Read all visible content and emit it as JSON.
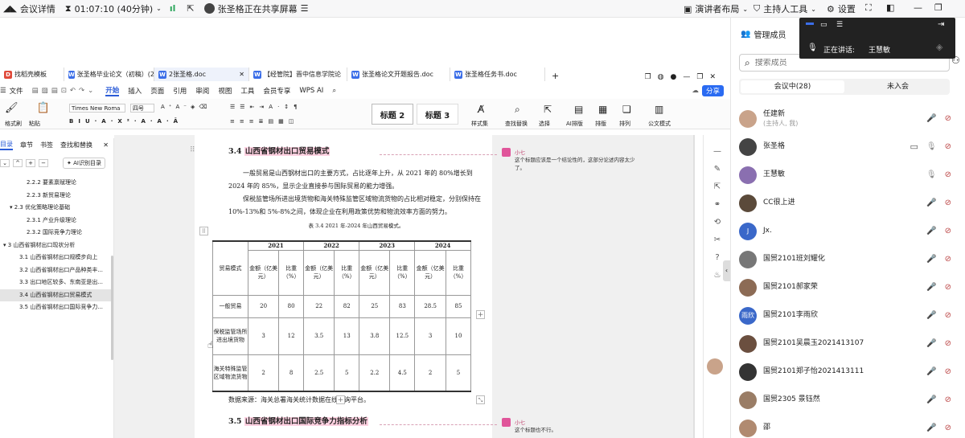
{
  "meeting_bar": {
    "details": "会议详情",
    "timer": "01:07:10 (40分钟)",
    "sharing": "张圣格正在共享屏幕",
    "layout": "演讲者布局",
    "host_tools": "主持人工具",
    "settings": "设置"
  },
  "float": {
    "speaking_label": "正在讲话:",
    "speaker": "王慧敏"
  },
  "doc_tabs": [
    {
      "label": "找稻壳模板"
    },
    {
      "label": "张圣格毕业论文（初稿）(2).d"
    },
    {
      "label": "2张圣格.doc"
    },
    {
      "label": "【经管院】晋中信息学院论"
    },
    {
      "label": "张圣格论文开题报告.doc"
    },
    {
      "label": "张圣格任务书.doc"
    }
  ],
  "menus": [
    "文件",
    "开始",
    "插入",
    "页面",
    "引用",
    "审阅",
    "视图",
    "工具",
    "会员专享",
    "WPS AI"
  ],
  "share_label": "分享",
  "ribbon": {
    "font": "Times New Roma",
    "size": "四号",
    "style1": "标题 2",
    "style2": "标题 3",
    "labels": [
      "样式集",
      "查找替换",
      "选择",
      "AI排版",
      "排版",
      "排列",
      "公文模式"
    ],
    "clipboard": [
      "格式刷",
      "粘贴"
    ]
  },
  "nav": {
    "tabs": [
      "目录",
      "章节",
      "书签",
      "查找和替换"
    ],
    "ai_button": "AI识别目录",
    "items": [
      {
        "label": "2.2.2 要素禀赋理论",
        "indent": 33
      },
      {
        "label": "2.2.3 新贸易理论",
        "indent": 33
      },
      {
        "label": "▾ 2.3 优化策略理论基础",
        "indent": 12
      },
      {
        "label": "2.3.1 产业升级理论",
        "indent": 33
      },
      {
        "label": "2.3.2 国际竞争力理论",
        "indent": 33
      },
      {
        "label": "▾ 3 山西省钢材出口现状分析",
        "indent": 4
      },
      {
        "label": "3.1 山西省钢材出口规模步向上",
        "indent": 24
      },
      {
        "label": "3.2 山西省钢材出口产品种类丰...",
        "indent": 24
      },
      {
        "label": "3.3 出口地区较多、东南亚是出...",
        "indent": 24
      },
      {
        "label": "3.4 山西省钢材出口贸易模式",
        "indent": 24,
        "active": true
      },
      {
        "label": "3.5 山西省钢材出口国际竞争力...",
        "indent": 24
      }
    ]
  },
  "document": {
    "heading34_num": "3.4",
    "heading34": "山西省钢材出口贸易模式",
    "para1": "一般贸易是山西钢材出口的主要方式，占比逐年上升，从 2021 年的 80%增长到 2024 年的 85%，显示企业直接参与国际贸易的能力增强。",
    "para2": "保税监管场所进出境货物和海关特殊监管区域物流货物的占比相对稳定，分别保持在 10%-13%和 5%-8%之间，体现企业在利用政策优势和物流效率方面的努力。",
    "table_caption": "表 3.4 2021 年-2024 年山西贸易模式。",
    "table": {
      "mode_header": "贸易模式",
      "years": [
        "2021",
        "2022",
        "2023",
        "2024"
      ],
      "amount_header": "金额（亿美元）",
      "ratio_header": "比重（%）",
      "rows": [
        {
          "mode": "一般贸易",
          "values": [
            "20",
            "80",
            "22",
            "82",
            "25",
            "83",
            "28.5",
            "85"
          ]
        },
        {
          "mode": "保税监管场所进出境货物",
          "values": [
            "3",
            "12",
            "3.5",
            "13",
            "3.8",
            "12.5",
            "3",
            "10"
          ]
        },
        {
          "mode": "海关特殊监管区域物流货物",
          "values": [
            "2",
            "8",
            "2.5",
            "5",
            "2.2",
            "4.5",
            "2",
            "5"
          ]
        }
      ]
    },
    "source": "数据来源：海关总署海关统计数据在线查询平台。",
    "heading35_num": "3.5",
    "heading35": "山西省钢材出口国际竞争力指标分析",
    "comments": [
      {
        "author": "小七",
        "text": "这个标题应该是一个结论性的，这部分论述内容太少了。"
      },
      {
        "author": "小七",
        "text": "这个标题也不行。"
      }
    ]
  },
  "panel": {
    "title": "管理成员",
    "search_placeholder": "搜索成员",
    "tab_in": "会议中(28)",
    "tab_out": "未入会",
    "members": [
      {
        "name": "任建新",
        "sub": "(主持人, 我)",
        "color": "#c9a38a",
        "initial": "",
        "extra": false
      },
      {
        "name": "张圣格",
        "sub": "",
        "color": "#444",
        "initial": "",
        "extra": true
      },
      {
        "name": "王慧敏",
        "sub": "",
        "color": "#8a6fb0",
        "initial": "",
        "extra": false
      },
      {
        "name": "CC很上进",
        "sub": "",
        "color": "#5b4a3a",
        "initial": "",
        "extra": false
      },
      {
        "name": "Jx.",
        "sub": "",
        "color": "#3a68c9",
        "initial": "J",
        "extra": false
      },
      {
        "name": "国贸2101班刘耀化",
        "sub": "",
        "color": "#777",
        "initial": "",
        "extra": false
      },
      {
        "name": "国贸2101郝家荣",
        "sub": "",
        "color": "#8c6b55",
        "initial": "",
        "extra": false
      },
      {
        "name": "国贸2101李雨欣",
        "sub": "",
        "color": "#3a68c9",
        "initial": "雨欣",
        "extra": false
      },
      {
        "name": "国贸2101吴晨玉2021413107",
        "sub": "",
        "color": "#6b4f3f",
        "initial": "",
        "extra": false
      },
      {
        "name": "国贸2101郑子怡2021413111",
        "sub": "",
        "color": "#333",
        "initial": "",
        "extra": false
      },
      {
        "name": "国贸2305 景钰然",
        "sub": "",
        "color": "#9a7d66",
        "initial": "",
        "extra": false
      },
      {
        "name": "邵",
        "sub": "",
        "color": "#b08a70",
        "initial": "",
        "extra": false
      }
    ]
  }
}
